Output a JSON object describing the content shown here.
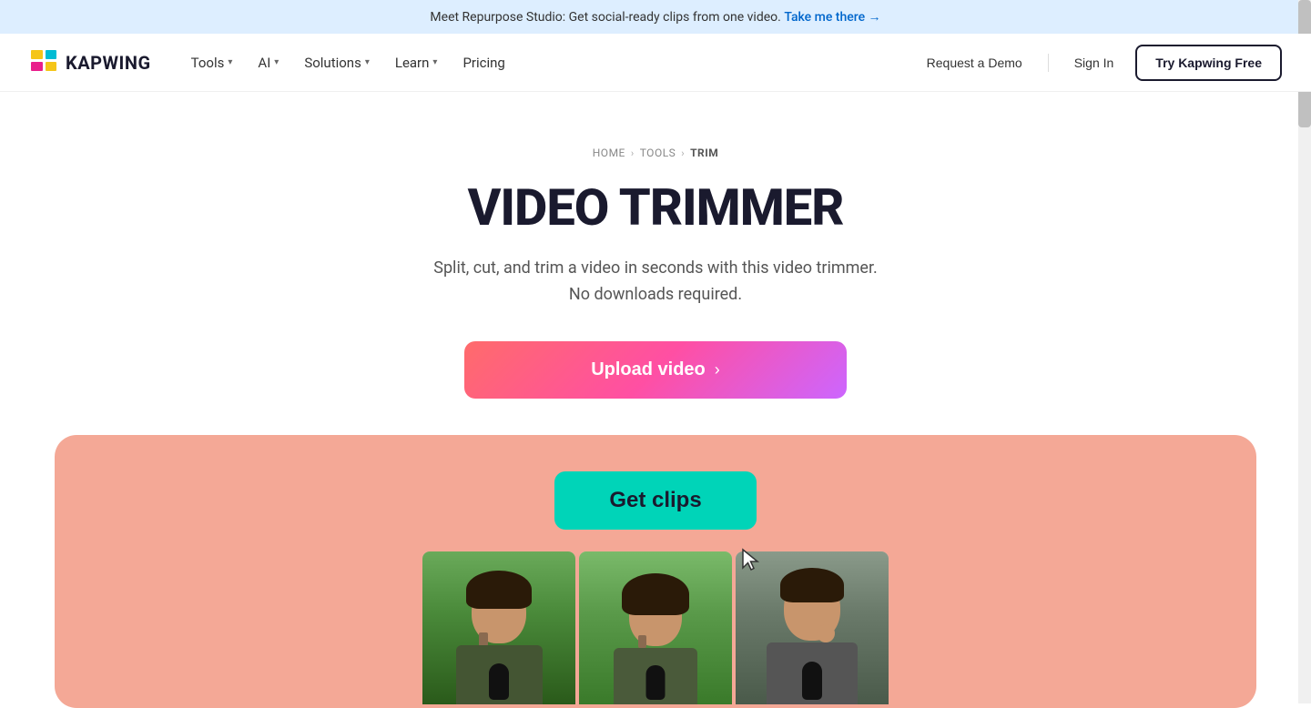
{
  "announcement": {
    "text": "Meet Repurpose Studio: Get social-ready clips from one video.",
    "link_text": "Take me there →",
    "link_href": "#"
  },
  "nav": {
    "logo_text": "KAPWING",
    "items": [
      {
        "label": "Tools",
        "has_dropdown": true
      },
      {
        "label": "AI",
        "has_dropdown": true
      },
      {
        "label": "Solutions",
        "has_dropdown": true
      },
      {
        "label": "Learn",
        "has_dropdown": true
      },
      {
        "label": "Pricing",
        "has_dropdown": false
      }
    ],
    "request_demo": "Request a Demo",
    "sign_in": "Sign In",
    "try_free": "Try Kapwing Free"
  },
  "hero": {
    "breadcrumb": {
      "home": "HOME",
      "tools": "TOOLS",
      "current": "TRIM"
    },
    "title": "VIDEO TRIMMER",
    "subtitle_line1": "Split, cut, and trim a video in seconds with this video trimmer.",
    "subtitle_line2": "No downloads required.",
    "upload_button": "Upload video",
    "upload_arrow": "›"
  },
  "demo": {
    "get_clips_button": "Get clips"
  }
}
